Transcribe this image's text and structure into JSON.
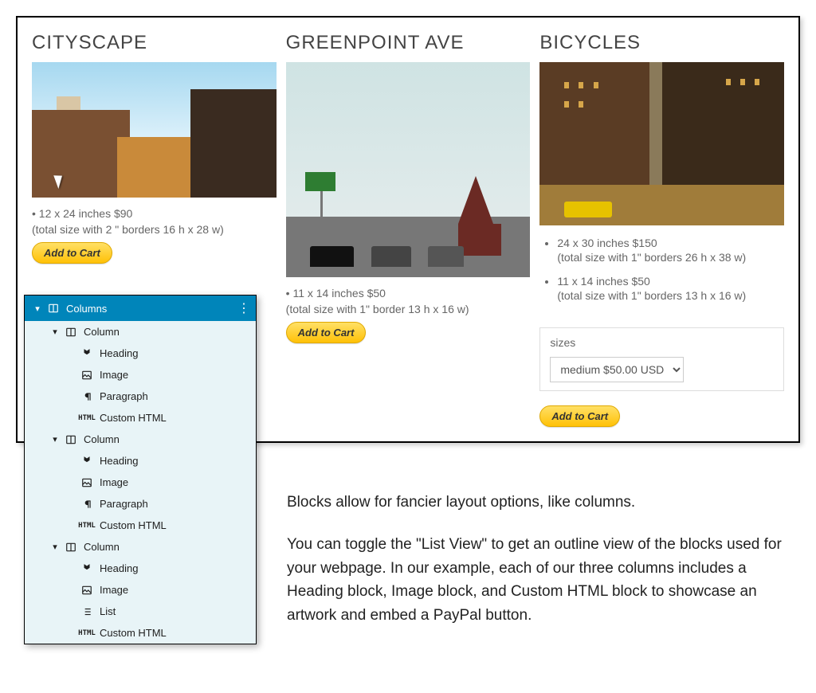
{
  "products": [
    {
      "title": "CITYSCAPE",
      "line1": "• 12 x 24 inches $90",
      "line2": "(total size with 2 \" borders 16 h x 28 w)",
      "button": "Add to Cart"
    },
    {
      "title": "GREENPOINT AVE",
      "line1": "• 11 x 14 inches $50",
      "line2": "(total size with 1\" border 13 h x 16 w)",
      "button": "Add to Cart"
    },
    {
      "title": "BICYCLES",
      "sizes": [
        {
          "line1": "24 x 30 inches $150",
          "line2": "(total size with 1\" borders 26 h x 38 w)"
        },
        {
          "line1": "11 x 14 inches $50",
          "line2": "(total size with 1\" borders 13 h x 16 w)"
        }
      ],
      "box_label": "sizes",
      "select_value": "medium $50.00 USD",
      "button": "Add to Cart"
    }
  ],
  "listview": {
    "header": "Columns",
    "columns": [
      {
        "label": "Column",
        "items": [
          "Heading",
          "Image",
          "Paragraph",
          "Custom HTML"
        ]
      },
      {
        "label": "Column",
        "items": [
          "Heading",
          "Image",
          "Paragraph",
          "Custom HTML"
        ]
      },
      {
        "label": "Column",
        "items": [
          "Heading",
          "Image",
          "List",
          "Custom HTML"
        ]
      }
    ]
  },
  "explain": {
    "p1": "Blocks allow for fancier layout options, like columns.",
    "p2": "You can toggle the \"List View\" to get an outline view of the blocks used for your webpage. In our example, each of our three columns includes a Heading block, Image block, and Custom HTML block to showcase an artwork and embed a PayPal button."
  },
  "icons": {
    "heading": "bookmark-icon",
    "image": "image-icon",
    "paragraph": "pilcrow-icon",
    "list": "list-icon",
    "custom_html": "html-badge",
    "column": "column-icon",
    "columns": "columns-icon"
  }
}
